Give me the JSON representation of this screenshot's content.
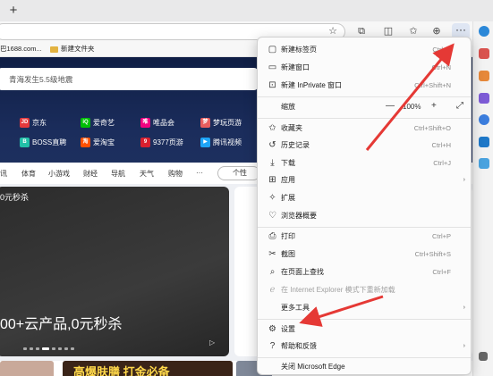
{
  "browser": {
    "new_tab_symbol": "+",
    "address_lock_icon": "lock-icon",
    "toolbar_icons": [
      "star-icon",
      "extensions-icon",
      "split-screen-icon",
      "favorites-icon",
      "collections-icon"
    ],
    "more_label": "···"
  },
  "favorites_bar": {
    "items": [
      {
        "label": "巴1688.com...",
        "icon": "site-icon"
      },
      {
        "label": "新建文件夹",
        "icon": "folder-icon"
      }
    ]
  },
  "webpage": {
    "search_placeholder": "青海发生5.5级地震",
    "sites_row1": [
      {
        "label": "京东",
        "badge": "JD",
        "color": "#e4393c"
      },
      {
        "label": "爱奇艺",
        "badge": "iQ",
        "color": "#00be06"
      },
      {
        "label": "唯品会",
        "badge": "唯",
        "color": "#f10180"
      },
      {
        "label": "梦玩页游",
        "badge": "梦",
        "color": "#e85d5d"
      }
    ],
    "sites_row2": [
      {
        "label": "BOSS直聘",
        "badge": "B",
        "color": "#22c0a8"
      },
      {
        "label": "爱淘宝",
        "badge": "淘",
        "color": "#ff5000"
      },
      {
        "label": "9377页游",
        "badge": "9",
        "color": "#d8202f"
      },
      {
        "label": "腾讯视频",
        "badge": "▶",
        "color": "#1ea4f7"
      }
    ],
    "nav_items": [
      "讯",
      "体育",
      "小游戏",
      "财经",
      "导航",
      "天气",
      "购物",
      "···"
    ],
    "personal_btn": "个性",
    "promo_top": "0元秒杀",
    "promo_main": "00+云产品,0元秒杀",
    "bottom_text": "高爆肤膳 打金必备"
  },
  "menu": {
    "items": [
      {
        "icon": "new-tab-icon",
        "label": "新建标签页",
        "shortcut": "Ctrl+T"
      },
      {
        "icon": "new-window-icon",
        "label": "新建窗口",
        "shortcut": "Ctrl+N"
      },
      {
        "icon": "inprivate-icon",
        "label": "新建 InPrivate 窗口",
        "shortcut": "Ctrl+Shift+N"
      },
      {
        "icon": "",
        "label": "缩放",
        "shortcut": ""
      },
      {
        "icon": "star-list-icon",
        "label": "收藏夹",
        "shortcut": "Ctrl+Shift+O"
      },
      {
        "icon": "history-icon",
        "label": "历史记录",
        "shortcut": "Ctrl+H"
      },
      {
        "icon": "download-icon",
        "label": "下载",
        "shortcut": "Ctrl+J"
      },
      {
        "icon": "apps-icon",
        "label": "应用",
        "shortcut": ""
      },
      {
        "icon": "extensions-icon",
        "label": "扩展",
        "shortcut": ""
      },
      {
        "icon": "essentials-icon",
        "label": "浏览器概要",
        "shortcut": ""
      },
      {
        "icon": "print-icon",
        "label": "打印",
        "shortcut": "Ctrl+P"
      },
      {
        "icon": "screenshot-icon",
        "label": "截图",
        "shortcut": "Ctrl+Shift+S"
      },
      {
        "icon": "find-icon",
        "label": "在页面上查找",
        "shortcut": "Ctrl+F"
      },
      {
        "icon": "ie-mode-icon",
        "label": "在 Internet Explorer 模式下重新加载",
        "shortcut": ""
      },
      {
        "icon": "",
        "label": "更多工具",
        "shortcut": ""
      },
      {
        "icon": "settings-icon",
        "label": "设置",
        "shortcut": ""
      },
      {
        "icon": "help-icon",
        "label": "帮助和反馈",
        "shortcut": ""
      },
      {
        "icon": "",
        "label": "关闭 Microsoft Edge",
        "shortcut": ""
      }
    ],
    "zoom": {
      "minus": "—",
      "value": "100%",
      "plus": "+",
      "fullscreen_icon": "fullscreen-icon"
    },
    "submenu_chevron": "›"
  },
  "colors": {
    "arrow": "#e53935",
    "menu_bg": "#fbfbfb",
    "page_hero": "#152550"
  }
}
